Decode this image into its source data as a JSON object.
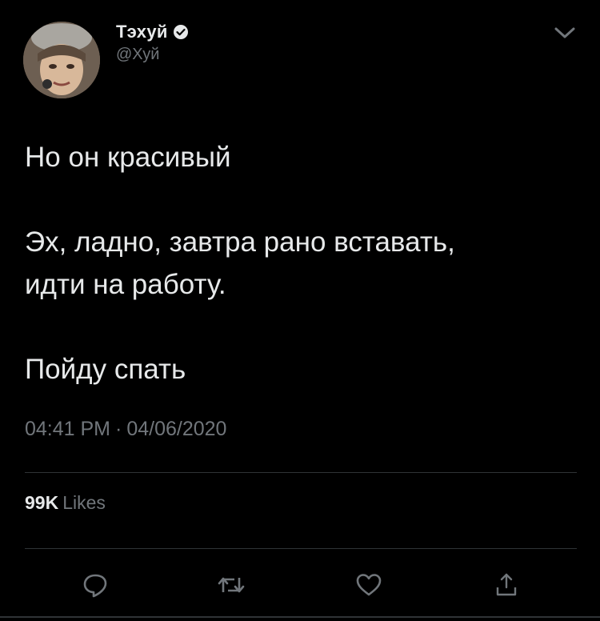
{
  "author": {
    "display_name": "Тэхуй",
    "handle": "@Хуй",
    "verified_icon": "verified-badge-icon",
    "avatar_icon": "avatar-photo"
  },
  "header": {
    "menu_icon": "chevron-down-icon"
  },
  "tweet": {
    "line1": "Но он красивый",
    "line2": "Эх, ладно, завтра рано вставать,",
    "line3": "идти на работу.",
    "line4": "Пойду спать"
  },
  "meta": {
    "time": "04:41 PM",
    "separator": "·",
    "date": "04/06/2020"
  },
  "stats": {
    "likes_count": "99K",
    "likes_label": "Likes"
  },
  "actions": {
    "reply_icon": "reply-icon",
    "retweet_icon": "retweet-icon",
    "like_icon": "heart-icon",
    "share_icon": "share-icon"
  },
  "colors": {
    "background": "#000000",
    "text": "#e7e9ea",
    "secondary_text": "#71767b",
    "divider": "#2f3336"
  }
}
